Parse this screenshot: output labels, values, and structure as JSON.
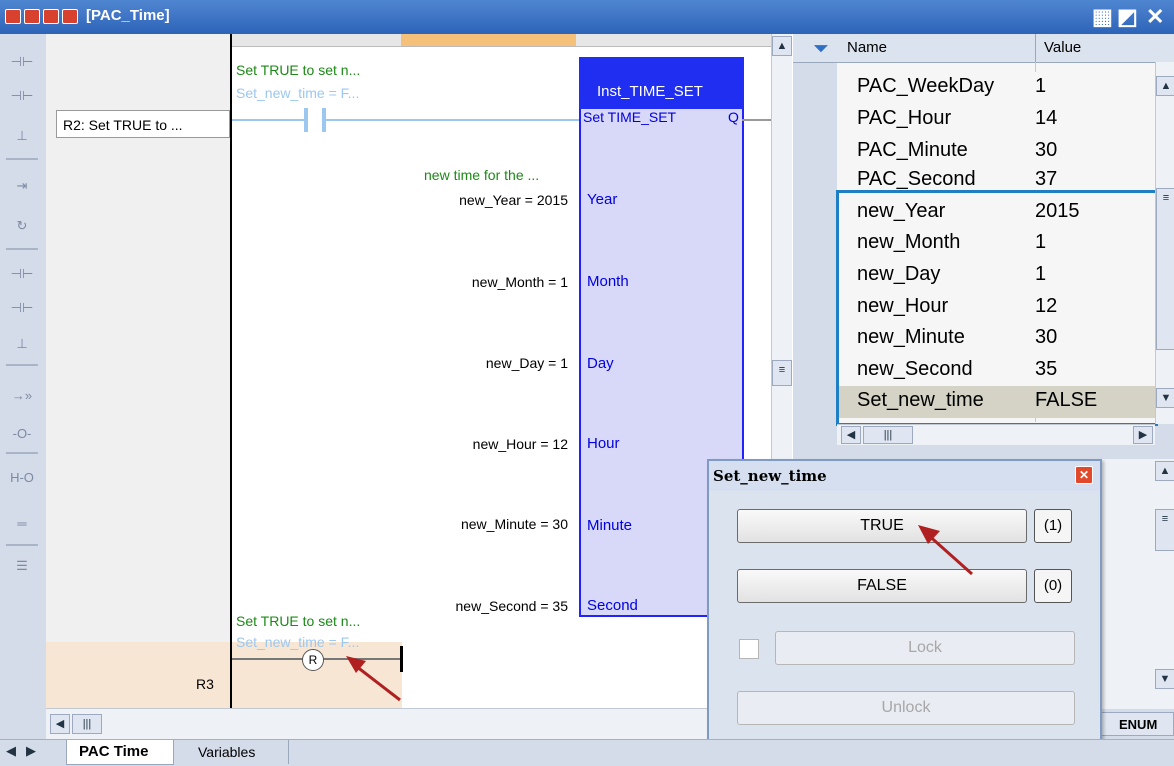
{
  "window": {
    "title": "[PAC_Time]"
  },
  "editor": {
    "rung2_label": "R2: Set TRUE to ...",
    "rung3_label": "R3",
    "comment_set": "Set TRUE to set n...",
    "set_new_time_var": "Set_new_time = F...",
    "comment_set_2": "Set TRUE to set n...",
    "set_new_time_var_2": "Set_new_time = F...",
    "reset_coil": "R",
    "comment_new_time": "new time for the ...",
    "fb_instance": "Inst_TIME_SET",
    "fb_type": "Set TIME_SET",
    "fb_output": "Q",
    "inputs": [
      {
        "expr": "new_Year = 2015",
        "pin": "Year"
      },
      {
        "expr": "new_Month = 1",
        "pin": "Month"
      },
      {
        "expr": "new_Day = 1",
        "pin": "Day"
      },
      {
        "expr": "new_Hour = 12",
        "pin": "Hour"
      },
      {
        "expr": "new_Minute = 30",
        "pin": "Minute"
      },
      {
        "expr": "new_Second = 35",
        "pin": "Second"
      }
    ]
  },
  "watch": {
    "col_name": "Name",
    "col_value": "Value",
    "rows": [
      {
        "name": "PAC_WeekDay",
        "value": "1"
      },
      {
        "name": "PAC_Hour",
        "value": "14"
      },
      {
        "name": "PAC_Minute",
        "value": "30"
      },
      {
        "name": "PAC_Second",
        "value": "37"
      },
      {
        "name": "new_Year",
        "value": "2015"
      },
      {
        "name": "new_Month",
        "value": "1"
      },
      {
        "name": "new_Day",
        "value": "1"
      },
      {
        "name": "new_Hour",
        "value": "12"
      },
      {
        "name": "new_Minute",
        "value": "30"
      },
      {
        "name": "new_Second",
        "value": "35"
      },
      {
        "name": "Set_new_time",
        "value": "FALSE"
      }
    ],
    "enum_label": "ENUM"
  },
  "dialog": {
    "title": "Set_new_time",
    "true_label": "TRUE",
    "true_key": "(1)",
    "false_label": "FALSE",
    "false_key": "(0)",
    "lock_label": "Lock",
    "unlock_label": "Unlock"
  },
  "tabs": [
    {
      "label": "PAC Time"
    },
    {
      "label": "Variables"
    }
  ],
  "colors": {
    "accent": "#1f7fc4",
    "arrow": "#b02020",
    "fb_border": "#2222ff"
  }
}
